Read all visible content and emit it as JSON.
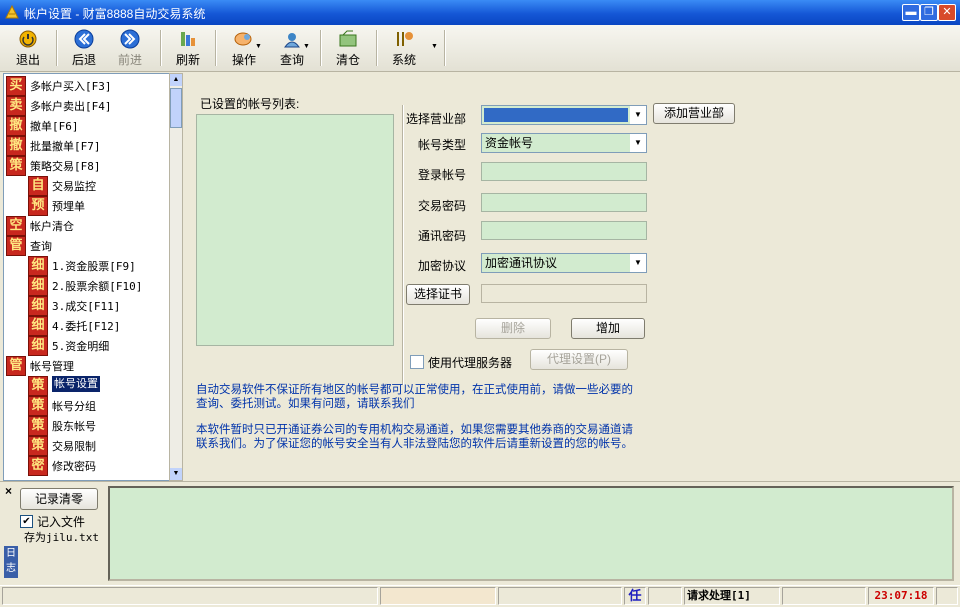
{
  "window": {
    "title": "帐户设置 - 财富8888自动交易系统",
    "controls": {
      "minimize": "▬",
      "restore": "❐",
      "close": "✕"
    }
  },
  "toolbar": {
    "exit": "退出",
    "back": "后退",
    "forward": "前进",
    "refresh": "刷新",
    "operate": "操作",
    "query": "查询",
    "clear": "清仓",
    "system": "系统"
  },
  "tree": {
    "items": [
      {
        "icon": "买",
        "label": "多帐户买入[F3]"
      },
      {
        "icon": "卖",
        "label": "多帐户卖出[F4]"
      },
      {
        "icon": "撤",
        "label": "撤单[F6]"
      },
      {
        "icon": "撤",
        "label": "批量撤单[F7]"
      },
      {
        "icon": "策",
        "label": "策略交易[F8]"
      },
      {
        "icon": "自",
        "label": "交易监控"
      },
      {
        "icon": "预",
        "label": "预埋单"
      },
      {
        "icon": "空",
        "label": "帐户清仓"
      },
      {
        "icon": "管",
        "label": "查询"
      },
      {
        "icon": "细",
        "label": "1.资金股票[F9]"
      },
      {
        "icon": "细",
        "label": "2.股票余额[F10]"
      },
      {
        "icon": "细",
        "label": "3.成交[F11]"
      },
      {
        "icon": "细",
        "label": "4.委托[F12]"
      },
      {
        "icon": "细",
        "label": "5.资金明细"
      },
      {
        "icon": "管",
        "label": "帐号管理"
      },
      {
        "icon": "策",
        "label": "帐号设置"
      },
      {
        "icon": "策",
        "label": "帐号分组"
      },
      {
        "icon": "策",
        "label": "股东帐号"
      },
      {
        "icon": "策",
        "label": "交易限制"
      },
      {
        "icon": "密",
        "label": "修改密码"
      }
    ]
  },
  "form": {
    "list_label": "已设置的帐号列表:",
    "branch_label": "选择营业部",
    "branch_value": "",
    "add_branch_button": "添加营业部",
    "type_label": "帐号类型",
    "type_value": "资金帐号",
    "login_label": "登录帐号",
    "trade_pwd_label": "交易密码",
    "comm_pwd_label": "通讯密码",
    "encrypt_label": "加密协议",
    "encrypt_value": "加密通讯协议",
    "cert_button": "选择证书",
    "delete_button": "删除",
    "add_button": "增加",
    "proxy_label": "使用代理服务器",
    "proxy_button": "代理设置(P)",
    "note1_line1": "自动交易软件不保证所有地区的帐号都可以正常使用，在正式使用前，请做一些必要的",
    "note1_line2": "查询、委托测试。如果有问题，请联系我们",
    "note2_line1": "本软件暂时只已开通证券公司的专用机构交易通道，如果您需要其他券商的交易通道请",
    "note2_line2": "联系我们。为了保证您的帐号安全当有人非法登陆您的软件后请重新设置的您的帐号。"
  },
  "bottom": {
    "close_glyph": "×",
    "clear_log_button": "记录清零",
    "log_to_file_label": "记入文件",
    "log_to_file_checked": true,
    "save_as_text": "存为jilu.txt",
    "side_tab": "日志"
  },
  "status": {
    "task_glyph": "任",
    "request_text": "请求处理[1]",
    "clock": "23:07:18"
  },
  "colors": {
    "accent": "#0A246A",
    "field_bg": "#D2EBCF",
    "note_text": "#0033AA",
    "clock_text": "#CC0000"
  }
}
